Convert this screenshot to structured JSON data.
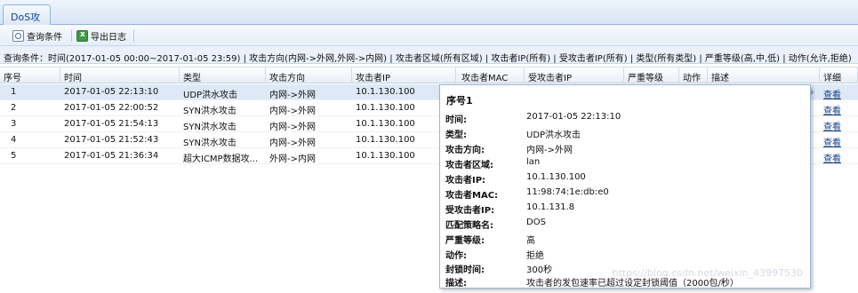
{
  "tab": {
    "label": "DoS攻击"
  },
  "toolbar": {
    "query_label": "查询条件",
    "export_label": "导出日志"
  },
  "conditions": "查询条件：时间(2017-01-05 00:00~2017-01-05 23:59) | 攻击方向(内网->外网,外网->内网) | 攻击者区域(所有区域) | 攻击者IP(所有) | 受攻击者IP(所有) | 类型(所有类型) | 严重等级(高,中,低) | 动作(允许,拒绝)",
  "columns": [
    "序号",
    "时间",
    "类型",
    "攻击方向",
    "攻击者IP",
    "攻击者MAC",
    "受攻击者IP",
    "严重等级",
    "动作",
    "描述",
    "详细"
  ],
  "rows": [
    {
      "no": "1",
      "time": "2017-01-05 22:13:10",
      "type": "UDP洪水攻击",
      "dir": "内网->外网",
      "ip": "10.1.130.100",
      "detail": "查看"
    },
    {
      "no": "2",
      "time": "2017-01-05 22:00:52",
      "type": "SYN洪水攻击",
      "dir": "内网->外网",
      "ip": "10.1.130.100",
      "detail": "查看"
    },
    {
      "no": "3",
      "time": "2017-01-05 21:54:13",
      "type": "SYN洪水攻击",
      "dir": "内网->外网",
      "ip": "10.1.130.100",
      "detail": "查看"
    },
    {
      "no": "4",
      "time": "2017-01-05 21:52:43",
      "type": "SYN洪水攻击",
      "dir": "内网->外网",
      "ip": "10.1.130.100",
      "detail": "查看"
    },
    {
      "no": "5",
      "time": "2017-01-05 21:36:34",
      "type": "超大ICMP数据攻...",
      "dir": "外网->内网",
      "ip": "10.1.130.100",
      "detail": "查看"
    }
  ],
  "popup": {
    "title": "序号1",
    "fields": [
      {
        "k": "时间:",
        "v": "2017-01-05 22:13:10"
      },
      {
        "k": "类型:",
        "v": "UDP洪水攻击"
      },
      {
        "k": "攻击方向:",
        "v": "内网->外网"
      },
      {
        "k": "攻击者区域:",
        "v": "lan"
      },
      {
        "k": "攻击者IP:",
        "v": "10.1.130.100"
      },
      {
        "k": "攻击者MAC:",
        "v": "11:98:74:1e:db:e0"
      },
      {
        "k": "受攻击者IP:",
        "v": "10.1.131.8"
      },
      {
        "k": "匹配策略名:",
        "v": "DOS"
      },
      {
        "k": "严重等级:",
        "v": "高"
      },
      {
        "k": "动作:",
        "v": "拒绝"
      },
      {
        "k": "封锁时间:",
        "v": "300秒"
      },
      {
        "k": "描述:",
        "v": "攻击者的发包速率已超过设定封锁阈值（2000包/秒）"
      }
    ]
  },
  "watermark": "https://blog.csdn.net/weixin_43997530"
}
